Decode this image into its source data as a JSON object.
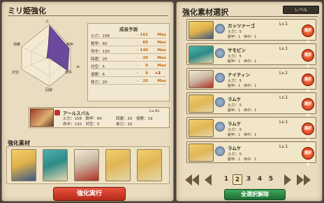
{
  "left": {
    "title": "ミリ姫強化",
    "radar_labels": [
      "火",
      "鋭甲",
      "命中",
      "回避",
      "対空",
      "偵察"
    ],
    "growth": {
      "title": "成長予測",
      "rows": [
        {
          "stat": "火力：158",
          "now": "161",
          "max": "Max",
          "plus": ""
        },
        {
          "stat": "鋭甲：60",
          "now": "60",
          "max": "Max",
          "plus": ""
        },
        {
          "stat": "命中：130",
          "now": "140",
          "max": "Max",
          "plus": ""
        },
        {
          "stat": "回避：20",
          "now": "20",
          "max": "Max",
          "plus": ""
        },
        {
          "stat": "対空：5",
          "now": "9",
          "max": "Max",
          "plus": ""
        },
        {
          "stat": "偵察：6",
          "now": "9",
          "max": "",
          "plus": "+3"
        },
        {
          "stat": "体力：20",
          "now": "20",
          "max": "Max",
          "plus": ""
        }
      ],
      "arrow": "»"
    },
    "base_card": {
      "name": "アールスバル",
      "level": "Lv.41",
      "line2": "火力：158　鋭甲：60",
      "line3": "命中：130　対空：5",
      "line4": "回避：20　偵察：19",
      "line5": "体力：20"
    },
    "materials_title": "強化素材",
    "action_button": "強化実行"
  },
  "right": {
    "title": "強化素材選択",
    "level_chip": "レベル",
    "items": [
      {
        "name": "カッツァーゴ",
        "level": "Lv.1",
        "stats": "火力：5",
        "stats2": "鋭甲：1　命中：1",
        "select": "選択中"
      },
      {
        "name": "サモビン",
        "level": "Lv.1",
        "stats": "火力：5",
        "stats2": "鋭甲：1　命中：1",
        "select": "選択中"
      },
      {
        "name": "ナイティン",
        "level": "Lv.1",
        "stats": "火力：5",
        "stats2": "鋭甲：1　命中：1",
        "select": "選択中"
      },
      {
        "name": "ラムケ",
        "level": "Lv.1",
        "stats": "火力：5",
        "stats2": "鋭甲：1　命中：1",
        "select": "選択中"
      },
      {
        "name": "ラムケ",
        "level": "Lv.1",
        "stats": "火力：5",
        "stats2": "鋭甲：1　命中：1",
        "select": "選択中"
      },
      {
        "name": "ラムケ",
        "level": "Lv.1",
        "stats": "火力：5",
        "stats2": "鋭甲：1　命中：1",
        "select": "選択中"
      }
    ],
    "pages": [
      "1",
      "2",
      "3",
      "4",
      "5"
    ],
    "current_page": "2",
    "clear_button": "全選択解除"
  },
  "colors": {
    "panel_bg": "#e9dcc0",
    "accent_orange": "#c16a10",
    "button_red": "#c53a24",
    "button_green": "#2a8a45",
    "radar_fill": "#6b4a9e"
  }
}
